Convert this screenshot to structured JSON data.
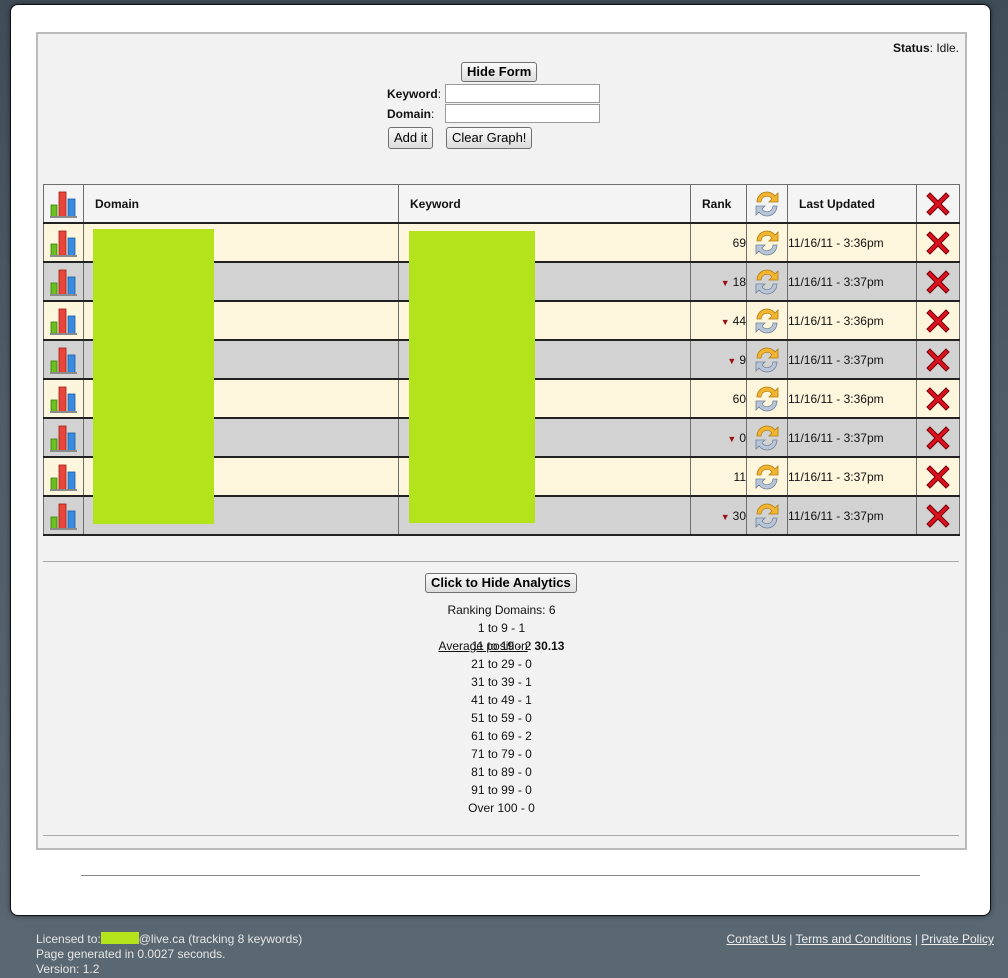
{
  "status": {
    "label": "Status",
    "value": "Idle."
  },
  "form": {
    "hide_label": "Hide Form",
    "keyword_label": "Keyword",
    "domain_label": "Domain",
    "keyword_value": "",
    "domain_value": "",
    "add_label": "Add it",
    "clear_label": "Clear Graph!"
  },
  "table": {
    "headers": {
      "domain": "Domain",
      "keyword": "Keyword",
      "rank": "Rank",
      "updated": "Last Updated"
    },
    "rows": [
      {
        "rank": "69",
        "trend": "none",
        "updated": "11/16/11 - 3:36pm"
      },
      {
        "rank": "18",
        "trend": "down",
        "updated": "11/16/11 - 3:37pm"
      },
      {
        "rank": "44",
        "trend": "down",
        "updated": "11/16/11 - 3:36pm"
      },
      {
        "rank": "9",
        "trend": "down",
        "updated": "11/16/11 - 3:37pm"
      },
      {
        "rank": "60",
        "trend": "none",
        "updated": "11/16/11 - 3:36pm"
      },
      {
        "rank": "0",
        "trend": "down",
        "updated": "11/16/11 - 3:37pm"
      },
      {
        "rank": "11",
        "trend": "none",
        "updated": "11/16/11 - 3:37pm"
      },
      {
        "rank": "30",
        "trend": "down",
        "updated": "11/16/11 - 3:37pm"
      }
    ]
  },
  "analytics": {
    "toggle_label": "Click to Hide Analytics",
    "ranking_domains": "Ranking Domains: 6",
    "buckets": [
      "1 to 9 - 1",
      "11 to 19 - 2",
      "21 to 29 - 0",
      "31 to 39 - 1",
      "41 to 49 - 1",
      "51 to 59 - 0",
      "61 to 69 - 2",
      "71 to 79 - 0",
      "81 to 89 - 0",
      "91 to 99 - 0",
      "Over 100 - 0"
    ],
    "average_label": "Average position",
    "average_value": "30.13"
  },
  "footer": {
    "licensed_prefix": "Licensed to:",
    "licensed_suffix": "@live.ca (tracking 8 keywords)",
    "generated": "Page generated in 0.0027 seconds.",
    "version": "Version: 1.2",
    "links": [
      "Contact Us",
      "Terms and Conditions",
      "Private Policy"
    ]
  },
  "icons": {
    "graph": "bar-chart-icon",
    "refresh": "refresh-icon",
    "delete": "red-x-icon"
  },
  "colors": {
    "redaction": "#b3e31b",
    "row_odd": "#fdf6dc",
    "row_even": "#d2d2d2",
    "delete_red": "#d8121e"
  }
}
